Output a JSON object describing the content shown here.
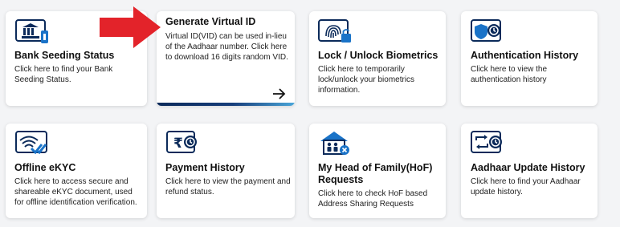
{
  "colors": {
    "page_bg": "#f3f4f6",
    "icon_navy": "#0b2a5a",
    "icon_blue": "#1a73c8",
    "pointer_red": "#e3232a"
  },
  "cards": [
    {
      "id": "bank-seeding",
      "icon": "bank-icon",
      "title": "Bank Seeding Status",
      "desc_lines": [
        "Click here to find your Bank",
        "Seeding Status."
      ]
    },
    {
      "id": "generate-vid",
      "icon": "",
      "title": "Generate Virtual ID",
      "desc_lines": [
        "Virtual ID(VID) can be used in-lieu",
        "of the Aadhaar number. Click here",
        "to download 16 digits random VID."
      ]
    },
    {
      "id": "lock-biometrics",
      "icon": "fingerprint-lock-icon",
      "title": "Lock / Unlock Biometrics",
      "desc_lines": [
        "Click here to temporarily",
        "lock/unlock your biometrics",
        "information."
      ]
    },
    {
      "id": "auth-history",
      "icon": "shield-history-icon",
      "title": "Authentication History",
      "desc_lines": [
        "Click here to view the",
        "authentication history"
      ]
    },
    {
      "id": "offline-ekyc",
      "icon": "wifi-check-icon",
      "title": "Offline eKYC",
      "desc_lines": [
        "Click here to access secure and",
        "shareable eKYC document, used",
        "for offline identification verification."
      ]
    },
    {
      "id": "payment-history",
      "icon": "rupee-history-icon",
      "title": "Payment History",
      "desc_lines": [
        "Click here to view the payment and",
        "refund status."
      ]
    },
    {
      "id": "hof-requests",
      "icon": "family-home-icon",
      "title_lines": [
        "My Head of Family(HoF)",
        "Requests"
      ],
      "desc_lines": [
        "Click here to check HoF based",
        "Address Sharing Requests"
      ]
    },
    {
      "id": "update-history",
      "icon": "update-history-icon",
      "title": "Aadhaar Update History",
      "desc_lines": [
        "Click here to find your Aadhaar",
        "update history."
      ]
    }
  ]
}
